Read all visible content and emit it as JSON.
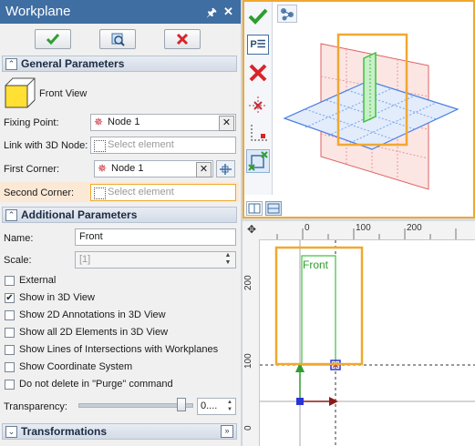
{
  "window": {
    "title": "Workplane"
  },
  "sections": {
    "general": "General Parameters",
    "additional": "Additional Parameters",
    "transformations": "Transformations"
  },
  "general": {
    "view_name": "Front View",
    "fixing_point_label": "Fixing Point:",
    "fixing_point_value": "Node 1",
    "link_3d_label": "Link with 3D Node:",
    "link_3d_placeholder": "Select element",
    "first_corner_label": "First Corner:",
    "first_corner_value": "Node 1",
    "second_corner_label": "Second Corner:",
    "second_corner_placeholder": "Select element"
  },
  "additional": {
    "name_label": "Name:",
    "name_value": "Front",
    "scale_label": "Scale:",
    "scale_value": "[1]",
    "checkboxes": [
      {
        "label": "External",
        "checked": false
      },
      {
        "label": "Show in 3D View",
        "checked": true
      },
      {
        "label": "Show 2D Annotations in 3D View",
        "checked": false
      },
      {
        "label": "Show all 2D Elements in 3D View",
        "checked": false
      },
      {
        "label": "Show Lines of Intersections with Workplanes",
        "checked": false
      },
      {
        "label": "Show Coordinate System",
        "checked": false
      },
      {
        "label": "Do not delete in \"Purge\" command",
        "checked": false
      }
    ],
    "transparency_label": "Transparency:",
    "transparency_value": "0....",
    "transparency_level": 0.95
  },
  "icons": {
    "pin": "pin-icon",
    "close": "close-icon",
    "ok": "checkmark-icon",
    "preview": "preview-icon",
    "cancel": "cancel-icon"
  },
  "viewport2d": {
    "ruler_top": [
      "0",
      "100",
      "200"
    ],
    "ruler_left": [
      "200",
      "100",
      "0"
    ],
    "label": "Front"
  },
  "colors": {
    "titlebar": "#3f6ea3",
    "ok_green": "#2e9e2e",
    "cancel_red": "#d9242a",
    "highlight_orange": "#f0a830",
    "plane_red": "#e06060",
    "plane_blue": "#4a7fe0",
    "plane_green": "#3cc23c"
  }
}
